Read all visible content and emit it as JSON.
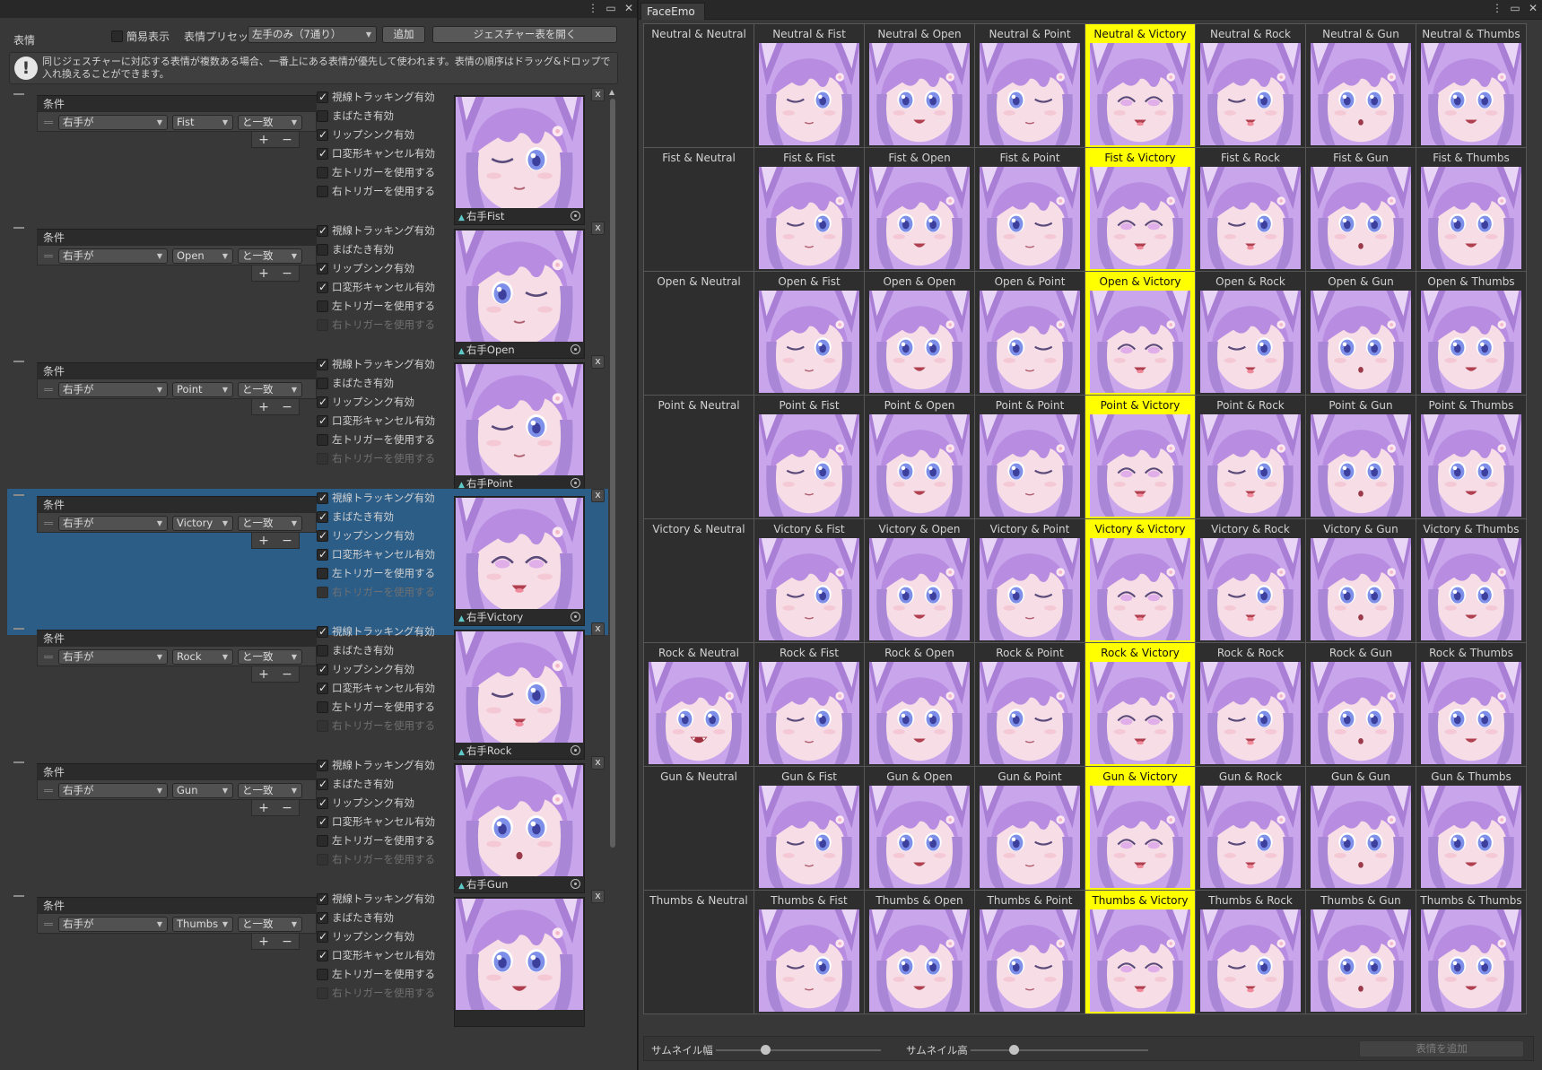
{
  "left_panel": {
    "title": "表情",
    "simple_view_label": "簡易表示",
    "simple_view_checked": false,
    "preset_label": "表情プリセット",
    "preset_value": "左手のみ（7通り）",
    "add_button": "追加",
    "open_gesture_button": "ジェスチャー表を開く",
    "info_icon": "!",
    "info_text": "同じジェスチャーに対応する表情が複数ある場合、一番上にある表情が優先して使われます。表情の順序はドラッグ&ドロップで入れ換えることができます。",
    "option_labels": [
      "視線トラッキング有効",
      "まばたき有効",
      "リップシンク有効",
      "口変形キャンセル有効",
      "左トリガーを使用する",
      "右トリガーを使用する"
    ],
    "condition_header": "条件",
    "plus": "+",
    "minus": "−",
    "remove": "x",
    "items": [
      {
        "hand": "右手が",
        "gesture": "Fist",
        "match": "と一致",
        "label": "右手Fist",
        "options": [
          true,
          false,
          true,
          true,
          false,
          false
        ],
        "disabled": [
          false,
          false,
          false,
          false,
          false,
          false
        ],
        "selected": false,
        "face": "wink"
      },
      {
        "hand": "右手が",
        "gesture": "Open",
        "match": "と一致",
        "label": "右手Open",
        "options": [
          true,
          false,
          true,
          true,
          false,
          false
        ],
        "disabled": [
          false,
          false,
          false,
          false,
          false,
          true
        ],
        "selected": false,
        "face": "wink-right"
      },
      {
        "hand": "右手が",
        "gesture": "Point",
        "match": "と一致",
        "label": "右手Point",
        "options": [
          true,
          false,
          true,
          true,
          false,
          false
        ],
        "disabled": [
          false,
          false,
          false,
          false,
          false,
          true
        ],
        "selected": false,
        "face": "wink"
      },
      {
        "hand": "右手が",
        "gesture": "Victory",
        "match": "と一致",
        "label": "右手Victory",
        "options": [
          true,
          true,
          true,
          true,
          false,
          false
        ],
        "disabled": [
          false,
          false,
          false,
          false,
          false,
          true
        ],
        "selected": true,
        "face": "happy"
      },
      {
        "hand": "右手が",
        "gesture": "Rock",
        "match": "と一致",
        "label": "右手Rock",
        "options": [
          true,
          false,
          true,
          true,
          false,
          false
        ],
        "disabled": [
          false,
          false,
          false,
          false,
          false,
          true
        ],
        "selected": false,
        "face": "wink-tongue"
      },
      {
        "hand": "右手が",
        "gesture": "Gun",
        "match": "と一致",
        "label": "右手Gun",
        "options": [
          true,
          true,
          true,
          true,
          false,
          false
        ],
        "disabled": [
          false,
          false,
          false,
          false,
          false,
          true
        ],
        "selected": false,
        "face": "surprised"
      },
      {
        "hand": "右手が",
        "gesture": "Thumbs",
        "match": "と一致",
        "label": "",
        "options": [
          true,
          true,
          true,
          true,
          false,
          false
        ],
        "disabled": [
          false,
          false,
          false,
          false,
          false,
          true
        ],
        "selected": false,
        "face": "open"
      }
    ]
  },
  "right_panel": {
    "tab_title": "FaceEmo",
    "gestures": [
      "Neutral",
      "Fist",
      "Open",
      "Point",
      "Victory",
      "Rock",
      "Gun",
      "Thumbs"
    ],
    "cell_separator": " & ",
    "highlight_column": "Victory",
    "highlight_color": "#ffff00",
    "column_faces": [
      "none",
      "wink",
      "open",
      "wink-right",
      "happy",
      "wink-tongue",
      "surprised",
      "open-mouth"
    ],
    "row_first_col_faces": {
      "Rock": "angry"
    },
    "slider_width_label": "サムネイル幅",
    "slider_height_label": "サムネイル高",
    "slider_width_value": 0.3,
    "slider_height_value": 0.24,
    "add_expression_button": "表情を追加"
  },
  "colors": {
    "selected_row": "#2c5d87",
    "hair": "#b88ce0",
    "skin": "#f6dde6",
    "eye": "#7d8fe8"
  }
}
